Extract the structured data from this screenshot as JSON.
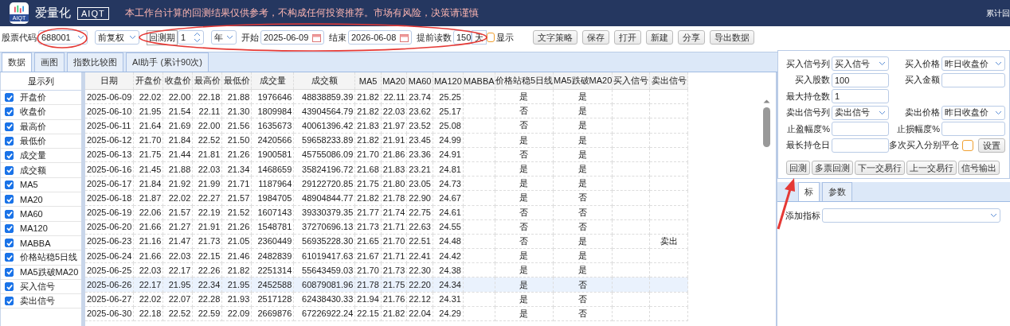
{
  "header": {
    "logo_caption": "AIQT",
    "app_name": "爱量化",
    "badge": "AIQT",
    "notice": "本工作台计算的回测结果仅供参考，不构成任何投资推荐。市场有风险，决策请谨慎",
    "right_text": "累计回"
  },
  "toolbar": {
    "stock_code": {
      "label": "股票代码",
      "value": "688001"
    },
    "adjust": {
      "value": "前复权"
    },
    "period": {
      "label": "回测期",
      "value": "1",
      "unit": "年"
    },
    "start": {
      "label": "开始",
      "value": "2025-06-09"
    },
    "end": {
      "label": "结束",
      "value": "2026-06-08"
    },
    "preload": {
      "label": "提前读数",
      "value": "150",
      "unit": "天"
    },
    "show": {
      "label": "显示",
      "checked": false
    },
    "buttons": [
      "文字策略",
      "保存",
      "打开",
      "新建",
      "分享",
      "导出数据"
    ]
  },
  "tabs": [
    {
      "label": "数据",
      "selected": true
    },
    {
      "label": "画图",
      "selected": false
    },
    {
      "label": "指数比较图",
      "selected": false
    },
    {
      "label": "AI助手 (累计90次)",
      "selected": false
    }
  ],
  "columns_panel": {
    "title": "显示列",
    "items": [
      {
        "label": "开盘价",
        "checked": true
      },
      {
        "label": "收盘价",
        "checked": true
      },
      {
        "label": "最高价",
        "checked": true
      },
      {
        "label": "最低价",
        "checked": true
      },
      {
        "label": "成交量",
        "checked": true
      },
      {
        "label": "成交额",
        "checked": true
      },
      {
        "label": "MA5",
        "checked": true
      },
      {
        "label": "MA20",
        "checked": true
      },
      {
        "label": "MA60",
        "checked": true
      },
      {
        "label": "MA120",
        "checked": true
      },
      {
        "label": "MABBA",
        "checked": true
      },
      {
        "label": "价格站稳5日线",
        "checked": true
      },
      {
        "label": "MA5跌破MA20",
        "checked": true
      },
      {
        "label": "买入信号",
        "checked": true
      },
      {
        "label": "卖出信号",
        "checked": true
      }
    ]
  },
  "table": {
    "columns": [
      "日期",
      "开盘价",
      "收盘价",
      "最高价",
      "最低价",
      "成交量",
      "成交额",
      "MA5",
      "MA20",
      "MA60",
      "MA120",
      "MABBA",
      "价格站稳5日线",
      "MA5跌破MA20",
      "买入信号",
      "卖出信号"
    ],
    "rows": [
      {
        "selected": false,
        "cells": [
          "2025-06-09",
          "22.02",
          "22.00",
          "22.18",
          "21.88",
          "1976646",
          "48838859.39",
          "21.82",
          "22.11",
          "23.74",
          "25.25",
          "",
          "是",
          "是",
          "",
          ""
        ]
      },
      {
        "selected": false,
        "cells": [
          "2025-06-10",
          "21.95",
          "21.54",
          "22.11",
          "21.30",
          "1809984",
          "43904564.79",
          "21.82",
          "22.03",
          "23.62",
          "25.17",
          "",
          "否",
          "是",
          "",
          ""
        ]
      },
      {
        "selected": false,
        "cells": [
          "2025-06-11",
          "21.64",
          "21.69",
          "22.00",
          "21.56",
          "1635673",
          "40061396.42",
          "21.83",
          "21.97",
          "23.52",
          "25.08",
          "",
          "否",
          "是",
          "",
          ""
        ]
      },
      {
        "selected": false,
        "cells": [
          "2025-06-12",
          "21.70",
          "21.84",
          "22.52",
          "21.50",
          "2420566",
          "59658233.89",
          "21.82",
          "21.91",
          "23.45",
          "24.99",
          "",
          "是",
          "是",
          "",
          ""
        ]
      },
      {
        "selected": false,
        "cells": [
          "2025-06-13",
          "21.75",
          "21.44",
          "21.81",
          "21.26",
          "1900581",
          "45755086.09",
          "21.70",
          "21.86",
          "23.36",
          "24.91",
          "",
          "否",
          "是",
          "",
          ""
        ]
      },
      {
        "selected": false,
        "cells": [
          "2025-06-16",
          "21.45",
          "21.88",
          "22.03",
          "21.34",
          "1468659",
          "35824196.72",
          "21.68",
          "21.83",
          "23.21",
          "24.81",
          "",
          "是",
          "是",
          "",
          ""
        ]
      },
      {
        "selected": false,
        "cells": [
          "2025-06-17",
          "21.84",
          "21.92",
          "21.99",
          "21.71",
          "1187964",
          "29122720.85",
          "21.75",
          "21.80",
          "23.05",
          "24.73",
          "",
          "是",
          "是",
          "",
          ""
        ]
      },
      {
        "selected": false,
        "cells": [
          "2025-06-18",
          "21.87",
          "22.02",
          "22.27",
          "21.57",
          "1984705",
          "48904844.77",
          "21.82",
          "21.78",
          "22.90",
          "24.67",
          "",
          "是",
          "否",
          "",
          ""
        ]
      },
      {
        "selected": false,
        "cells": [
          "2025-06-19",
          "22.06",
          "21.57",
          "22.19",
          "21.52",
          "1607143",
          "39330379.35",
          "21.77",
          "21.74",
          "22.75",
          "24.61",
          "",
          "否",
          "否",
          "",
          ""
        ]
      },
      {
        "selected": false,
        "cells": [
          "2025-06-20",
          "21.66",
          "21.27",
          "21.91",
          "21.26",
          "1548781",
          "37270696.13",
          "21.73",
          "21.71",
          "22.63",
          "24.55",
          "",
          "否",
          "否",
          "",
          ""
        ]
      },
      {
        "selected": false,
        "cells": [
          "2025-06-23",
          "21.16",
          "21.47",
          "21.73",
          "21.05",
          "2360449",
          "56935228.30",
          "21.65",
          "21.70",
          "22.51",
          "24.48",
          "",
          "否",
          "是",
          "",
          "卖出"
        ]
      },
      {
        "selected": false,
        "cells": [
          "2025-06-24",
          "21.66",
          "22.03",
          "22.15",
          "21.46",
          "2482839",
          "61019417.63",
          "21.67",
          "21.71",
          "22.41",
          "24.42",
          "",
          "是",
          "是",
          "",
          ""
        ]
      },
      {
        "selected": false,
        "cells": [
          "2025-06-25",
          "22.03",
          "22.17",
          "22.26",
          "21.82",
          "2251314",
          "55643459.03",
          "21.70",
          "21.73",
          "22.30",
          "24.38",
          "",
          "是",
          "是",
          "",
          ""
        ]
      },
      {
        "selected": true,
        "cells": [
          "2025-06-26",
          "22.17",
          "21.95",
          "22.34",
          "21.95",
          "2452588",
          "60879081.96",
          "21.78",
          "21.75",
          "22.20",
          "24.34",
          "",
          "是",
          "否",
          "",
          ""
        ]
      },
      {
        "selected": false,
        "cells": [
          "2025-06-27",
          "22.02",
          "22.07",
          "22.28",
          "21.93",
          "2517128",
          "62438430.33",
          "21.94",
          "21.76",
          "22.12",
          "24.31",
          "",
          "是",
          "否",
          "",
          ""
        ]
      },
      {
        "selected": false,
        "cells": [
          "2025-06-30",
          "22.18",
          "22.52",
          "22.59",
          "22.09",
          "2669876",
          "67226922.24",
          "22.15",
          "21.82",
          "22.04",
          "24.29",
          "",
          "是",
          "否",
          "",
          ""
        ]
      }
    ]
  },
  "form": {
    "rows": [
      [
        {
          "kind": "select",
          "label": "买入信号列",
          "value": "买入信号"
        },
        {
          "kind": "select",
          "label": "买入价格",
          "value": "昨日收盘价"
        }
      ],
      [
        {
          "kind": "input",
          "label": "买入股数",
          "value": "100"
        },
        {
          "kind": "input",
          "label": "买入金额"
        }
      ],
      [
        {
          "kind": "input",
          "label": "最大持仓数",
          "value": "1"
        }
      ],
      [
        {
          "kind": "select",
          "label": "卖出信号列",
          "value": "卖出信号"
        },
        {
          "kind": "select",
          "label": "卖出价格",
          "value": "昨日收盘价"
        }
      ],
      [
        {
          "kind": "input",
          "label": "止盈幅度%"
        },
        {
          "kind": "input",
          "label": "止损幅度%"
        }
      ],
      [
        {
          "kind": "input",
          "label": "最长持仓日"
        },
        {
          "kind": "checkbox",
          "label": "多次买入分别平仓",
          "checked": false,
          "button": "设置"
        }
      ]
    ],
    "actions": [
      "回测",
      "多票回测",
      "下一交易行",
      "上一交易行",
      "信号输出"
    ]
  },
  "bottom_tabs": [
    {
      "label": "标",
      "selected": true
    },
    {
      "label": "参数",
      "selected": false
    }
  ],
  "add_indicator": {
    "label": "添加指标"
  }
}
